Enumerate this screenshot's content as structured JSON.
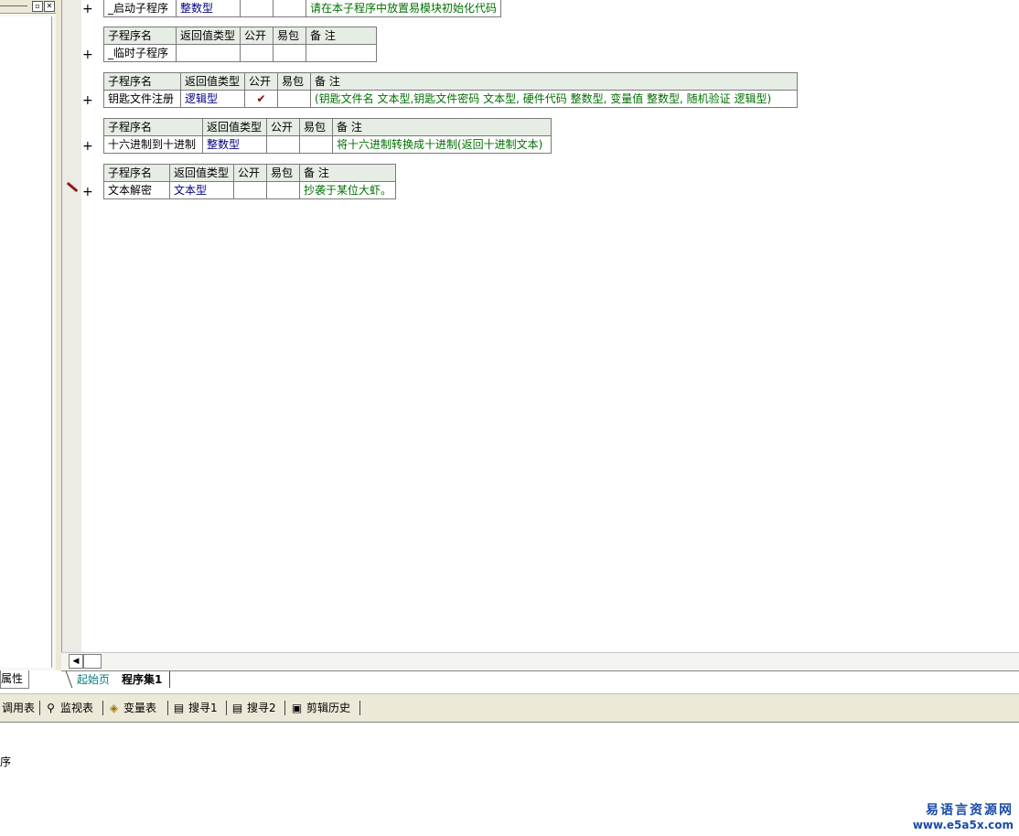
{
  "left_panel": {
    "bottom_tab": "属性"
  },
  "table_headers": {
    "name": "子程序名",
    "return_type": "返回值类型",
    "public": "公开",
    "easy_pack": "易包",
    "note": "备 注"
  },
  "subroutines": [
    {
      "name": "_启动子程序",
      "return_type": "整数型",
      "public": "",
      "easy_pack": "",
      "note": "请在本子程序中放置易模块初始化代码"
    },
    {
      "name": "_临时子程序",
      "return_type": "",
      "public": "",
      "easy_pack": "",
      "note": ""
    },
    {
      "name": "钥匙文件注册",
      "return_type": "逻辑型",
      "public": "✔",
      "easy_pack": "",
      "note": "(钥匙文件名 文本型,钥匙文件密码 文本型, 硬件代码 整数型, 变量值 整数型, 随机验证 逻辑型)"
    },
    {
      "name": "十六进制到十进制",
      "return_type": "整数型",
      "public": "",
      "easy_pack": "",
      "note": "将十六进制转换成十进制(返回十进制文本)"
    },
    {
      "name": "文本解密",
      "return_type": "文本型",
      "public": "",
      "easy_pack": "",
      "note": "抄袭于某位大虾。"
    }
  ],
  "plus_symbol": "+",
  "editor_tabs": [
    {
      "label": "起始页"
    },
    {
      "label": "程序集1"
    }
  ],
  "toolbar": [
    {
      "label": "调用表",
      "icon": "call-table-icon"
    },
    {
      "label": "监视表",
      "icon": "magnifier-icon"
    },
    {
      "label": "变量表",
      "icon": "variables-icon"
    },
    {
      "label": "搜寻1",
      "icon": "search1-icon"
    },
    {
      "label": "搜寻2",
      "icon": "search2-icon"
    },
    {
      "label": "剪辑历史",
      "icon": "clipboard-icon"
    }
  ],
  "output": {
    "text": "序"
  },
  "watermark": {
    "cn": "易语言资源网",
    "url": "www.e5a5x.com"
  }
}
